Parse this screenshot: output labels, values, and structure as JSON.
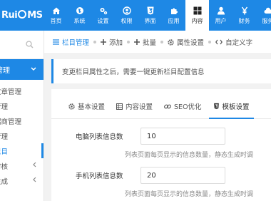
{
  "logo": {
    "text_before": "Rui",
    "text_after": "MS"
  },
  "nav": [
    {
      "label": "首页",
      "icon": "home-icon"
    },
    {
      "label": "系统",
      "icon": "globe-icon"
    },
    {
      "label": "设置",
      "icon": "gears-icon"
    },
    {
      "label": "权限",
      "icon": "user-circle-icon"
    },
    {
      "label": "界面",
      "icon": "html5-icon"
    },
    {
      "label": "应用",
      "icon": "puzzle-icon"
    },
    {
      "label": "内容",
      "icon": "grid-icon",
      "active": true
    },
    {
      "label": "用户",
      "icon": "user-icon"
    },
    {
      "label": "财务",
      "icon": "yen-icon"
    },
    {
      "label": "服务",
      "icon": "cloud-icon"
    }
  ],
  "sidebar": {
    "group_label": "管理",
    "items": [
      {
        "label": "文章管理"
      },
      {
        "label": "管理"
      },
      {
        "label": "招商管理"
      },
      {
        "label": "管理"
      },
      {
        "label": "栏目",
        "active": true
      },
      {
        "label": "审核"
      },
      {
        "label": "生成"
      }
    ]
  },
  "tabbar": {
    "items": [
      {
        "label": "栏目管理",
        "icon": "list-icon",
        "active": true
      },
      {
        "label": "添加",
        "icon": "plus-icon"
      },
      {
        "label": "批量",
        "icon": "plus-icon"
      },
      {
        "label": "属性设置",
        "icon": "gear-icon"
      },
      {
        "label": "自定义字",
        "icon": "code-icon"
      }
    ]
  },
  "notice": "变更栏目属性之后，需要一键更新栏目配置信息",
  "panel_tabs": [
    {
      "label": "基本设置",
      "icon": "gear-icon"
    },
    {
      "label": "内容设置",
      "icon": "table-icon"
    },
    {
      "label": "SEO优化",
      "icon": "link-icon"
    },
    {
      "label": "模板设置",
      "icon": "html5-icon",
      "active": true
    }
  ],
  "form": {
    "pc_label": "电脑列表信息数",
    "pc_value": "10",
    "pc_hint": "列表页面每页显示的信息数量，静态生成时调",
    "mobile_label": "手机列表信息数",
    "mobile_value": "20",
    "mobile_hint": "列表页面每页显示的信息数量，静态生成时调"
  }
}
